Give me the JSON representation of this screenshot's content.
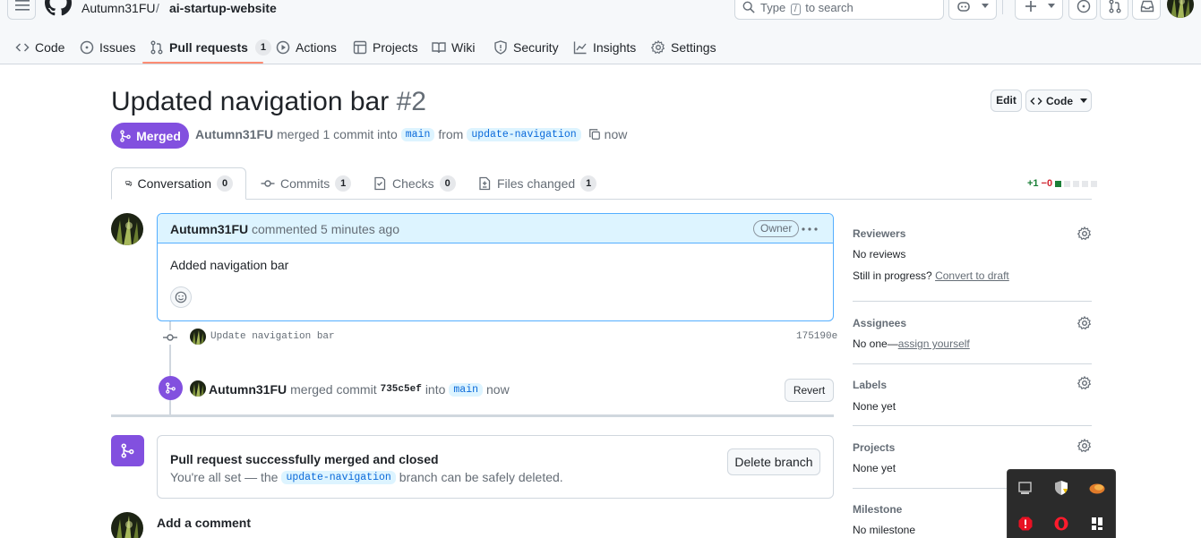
{
  "header": {
    "owner": "Autumn31FU",
    "separator": "/",
    "repo": "ai-startup-website",
    "search_prefix": "Type",
    "search_key": "/",
    "search_suffix": "to search"
  },
  "repo_nav": [
    {
      "label": "Code",
      "icon": "code-icon"
    },
    {
      "label": "Issues",
      "icon": "issue-icon"
    },
    {
      "label": "Pull requests",
      "icon": "pull-request-icon",
      "count": "1",
      "active": true
    },
    {
      "label": "Actions",
      "icon": "play-icon"
    },
    {
      "label": "Projects",
      "icon": "table-icon"
    },
    {
      "label": "Wiki",
      "icon": "book-icon"
    },
    {
      "label": "Security",
      "icon": "shield-icon"
    },
    {
      "label": "Insights",
      "icon": "graph-icon"
    },
    {
      "label": "Settings",
      "icon": "gear-icon"
    }
  ],
  "pr": {
    "title": "Updated navigation bar",
    "number": "#2",
    "edit_label": "Edit",
    "code_label": "Code",
    "state": "Merged",
    "author": "Autumn31FU",
    "meta_merged": "merged 1 commit into",
    "base": "main",
    "meta_from": "from",
    "head": "update-navigation",
    "when": "now"
  },
  "tabs": [
    {
      "label": "Conversation",
      "count": "0",
      "icon": "comment-icon",
      "active": true
    },
    {
      "label": "Commits",
      "count": "1",
      "icon": "commit-icon"
    },
    {
      "label": "Checks",
      "count": "0",
      "icon": "checklist-icon"
    },
    {
      "label": "Files changed",
      "count": "1",
      "icon": "file-diff-icon"
    }
  ],
  "diffstat": {
    "additions": "+1",
    "deletions": "−0",
    "add_color": "#1a7f37",
    "del_color": "#d1242f"
  },
  "comment": {
    "author": "Autumn31FU",
    "action": "commented 5 minutes ago",
    "badge": "Owner",
    "body": "Added navigation bar"
  },
  "commit": {
    "message": "Update navigation bar",
    "sha": "175190e"
  },
  "merge_event": {
    "author": "Autumn31FU",
    "text_merged": "merged commit",
    "sha": "735c5ef",
    "text_into": "into",
    "base": "main",
    "when": "now",
    "revert_label": "Revert"
  },
  "merged_box": {
    "title": "Pull request successfully merged and closed",
    "line_prefix": "You're all set — the",
    "branch": "update-navigation",
    "line_suffix": "branch can be safely deleted.",
    "delete_label": "Delete branch"
  },
  "add_comment": {
    "title": "Add a comment"
  },
  "sidebar": {
    "reviewers": {
      "heading": "Reviewers",
      "value": "No reviews",
      "progress_prefix": "Still in progress?",
      "progress_link": "Convert to draft"
    },
    "assignees": {
      "heading": "Assignees",
      "value_prefix": "No one—",
      "value_link": "assign yourself"
    },
    "labels": {
      "heading": "Labels",
      "value": "None yet"
    },
    "projects": {
      "heading": "Projects",
      "value": "None yet"
    },
    "milestone": {
      "heading": "Milestone",
      "value": "No milestone"
    }
  },
  "colors": {
    "merged_purple": "#8250df",
    "link_blue": "#0969da",
    "active_tab_underline": "#fd8c73"
  },
  "tray_icons": [
    "monitor-icon",
    "security-shield-icon",
    "cloud-app-icon",
    "alert-icon",
    "opera-icon",
    "app-icon"
  ]
}
